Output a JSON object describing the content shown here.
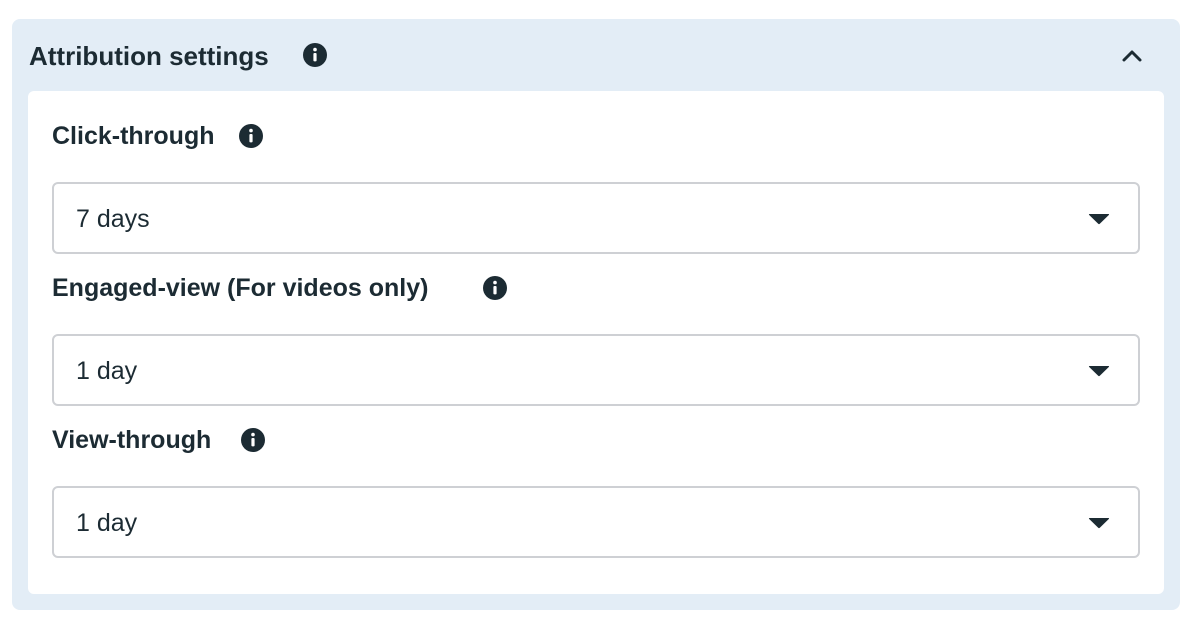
{
  "panel": {
    "title": "Attribution settings",
    "info_icon": "info-icon",
    "collapse_icon": "chevron-up-icon"
  },
  "fields": [
    {
      "label": "Click-through",
      "value": "7 days",
      "info_icon": "info-icon",
      "caret_icon": "caret-down-icon"
    },
    {
      "label": "Engaged-view (For videos only)",
      "value": "1 day",
      "info_icon": "info-icon",
      "caret_icon": "caret-down-icon"
    },
    {
      "label": "View-through",
      "value": "1 day",
      "info_icon": "info-icon",
      "caret_icon": "caret-down-icon"
    }
  ],
  "colors": {
    "panel_bg": "#e3edf6",
    "card_bg": "#ffffff",
    "text": "#1c2b33",
    "border": "#ced0d4"
  }
}
